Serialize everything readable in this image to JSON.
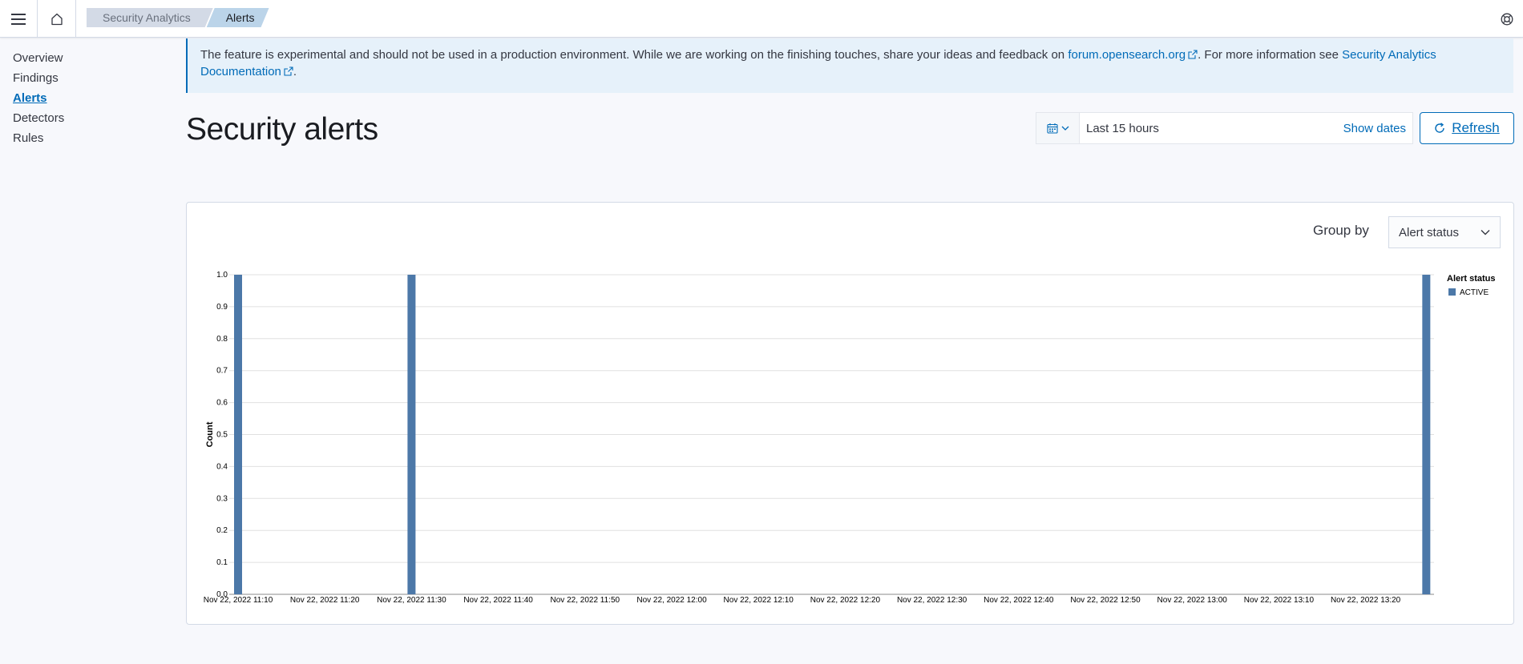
{
  "header": {
    "breadcrumbs": [
      "Security Analytics",
      "Alerts"
    ]
  },
  "sidebar": {
    "items": [
      {
        "label": "Overview",
        "active": false
      },
      {
        "label": "Findings",
        "active": false
      },
      {
        "label": "Alerts",
        "active": true
      },
      {
        "label": "Detectors",
        "active": false
      },
      {
        "label": "Rules",
        "active": false
      }
    ]
  },
  "callout": {
    "text_before": "The feature is experimental and should not be used in a production environment. While we are working on the finishing touches, share your ideas and feedback on ",
    "forum_link": "forum.opensearch.org",
    "text_middle": ". For more information see ",
    "docs_link": "Security Analytics Documentation",
    "text_end": "."
  },
  "page": {
    "title": "Security alerts"
  },
  "datepicker": {
    "range_text": "Last 15 hours",
    "show_dates": "Show dates"
  },
  "refresh": {
    "label": "Refresh"
  },
  "groupby": {
    "label": "Group by",
    "selected": "Alert status"
  },
  "colors": {
    "accent": "#006bb8",
    "bar": "#4c78a8"
  },
  "chart_data": {
    "type": "bar",
    "ylabel": "Count",
    "xlabel": "",
    "ylim": [
      0,
      1.0
    ],
    "yticks": [
      "0.0",
      "0.1",
      "0.2",
      "0.3",
      "0.4",
      "0.5",
      "0.6",
      "0.7",
      "0.8",
      "0.9",
      "1.0"
    ],
    "xticks": [
      "Nov 22, 2022 11:10",
      "Nov 22, 2022 11:20",
      "Nov 22, 2022 11:30",
      "Nov 22, 2022 11:40",
      "Nov 22, 2022 11:50",
      "Nov 22, 2022 12:00",
      "Nov 22, 2022 12:10",
      "Nov 22, 2022 12:20",
      "Nov 22, 2022 12:30",
      "Nov 22, 2022 12:40",
      "Nov 22, 2022 12:50",
      "Nov 22, 2022 13:00",
      "Nov 22, 2022 13:10",
      "Nov 22, 2022 13:20"
    ],
    "legend": {
      "title": "Alert status",
      "placement": "top-right"
    },
    "series": [
      {
        "name": "ACTIVE",
        "points": [
          {
            "x": "Nov 22, 2022 11:10",
            "y": 1
          },
          {
            "x": "Nov 22, 2022 11:30",
            "y": 1
          },
          {
            "x": "Nov 22, 2022 13:27",
            "y": 1
          }
        ]
      }
    ],
    "grid": true
  }
}
